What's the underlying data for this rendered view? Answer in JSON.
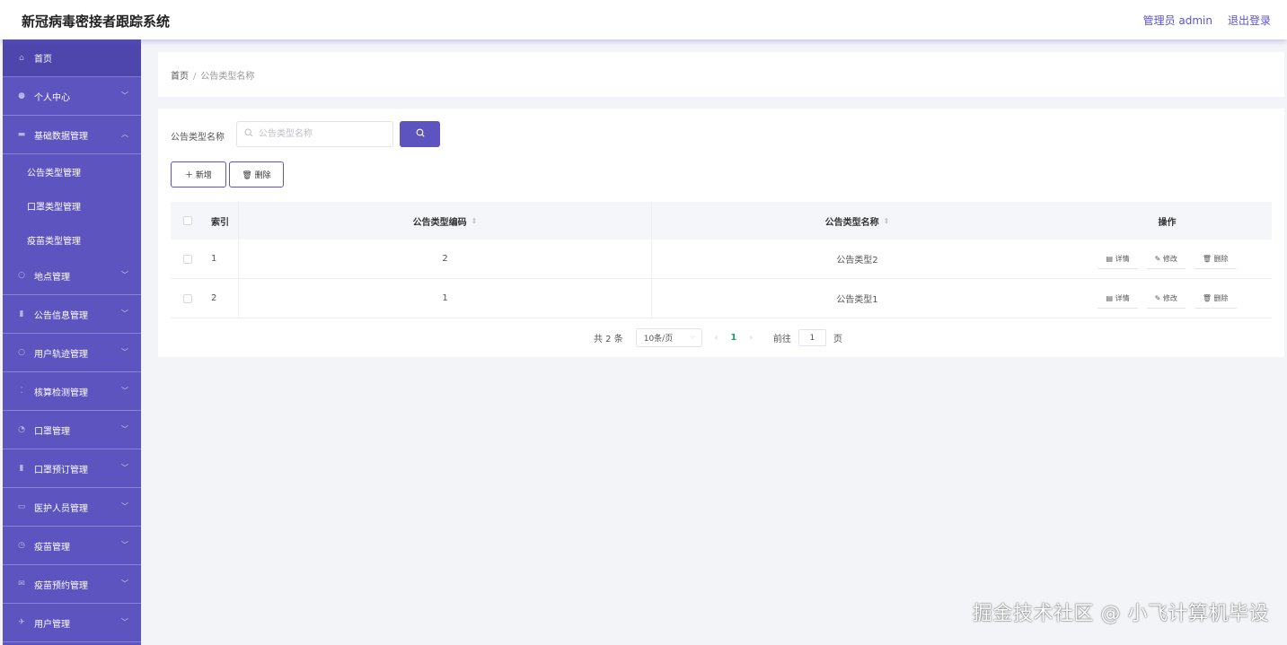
{
  "header": {
    "title": "新冠病毒密接者跟踪系统",
    "user_label": "管理员 admin",
    "logout_label": "退出登录"
  },
  "sidebar": {
    "items": [
      {
        "label": "首页",
        "icon": "home-icon",
        "glyph": "⌂",
        "expandable": false,
        "active": true
      },
      {
        "label": "个人中心",
        "icon": "user-icon",
        "glyph": "●",
        "expandable": true
      },
      {
        "label": "基础数据管理",
        "icon": "data-icon",
        "glyph": "▬",
        "expandable": true,
        "expanded": true,
        "children": [
          "公告类型管理",
          "口罩类型管理",
          "疫苗类型管理"
        ]
      },
      {
        "label": "地点管理",
        "icon": "location-icon",
        "glyph": "○",
        "expandable": true
      },
      {
        "label": "公告信息管理",
        "icon": "notice-icon",
        "glyph": "▮",
        "expandable": true
      },
      {
        "label": "用户轨迹管理",
        "icon": "track-icon",
        "glyph": "○",
        "expandable": true
      },
      {
        "label": "核算检测管理",
        "icon": "test-icon",
        "glyph": "⁚",
        "expandable": true
      },
      {
        "label": "口罩管理",
        "icon": "mask-icon",
        "glyph": "◔",
        "expandable": true
      },
      {
        "label": "口罩预订管理",
        "icon": "order-icon",
        "glyph": "▮",
        "expandable": true
      },
      {
        "label": "医护人员管理",
        "icon": "staff-icon",
        "glyph": "▭",
        "expandable": true
      },
      {
        "label": "疫苗管理",
        "icon": "vaccine-icon",
        "glyph": "◷",
        "expandable": true
      },
      {
        "label": "疫苗预约管理",
        "icon": "appointment-icon",
        "glyph": "✉",
        "expandable": true
      },
      {
        "label": "用户管理",
        "icon": "send-icon",
        "glyph": "✈",
        "expandable": true
      }
    ]
  },
  "breadcrumb": {
    "home": "首页",
    "separator": "/",
    "current": "公告类型名称"
  },
  "search": {
    "label": "公告类型名称",
    "placeholder": "公告类型名称",
    "button_icon": "search-icon"
  },
  "actions": {
    "add_label": "＋ 新增",
    "delete_label": "🗑 删除"
  },
  "table": {
    "headers": {
      "index": "索引",
      "code": "公告类型编码",
      "name": "公告类型名称",
      "ops": "操作"
    },
    "rows": [
      {
        "index": "1",
        "code": "2",
        "name": "公告类型2"
      },
      {
        "index": "2",
        "code": "1",
        "name": "公告类型1"
      }
    ],
    "row_ops": {
      "detail": "▤ 详情",
      "edit": "✎ 修改",
      "delete": "🗑 删除"
    }
  },
  "pagination": {
    "total_text": "共 2 条",
    "page_size": "10条/页",
    "current_page": "1",
    "goto_label": "前往",
    "goto_value": "1",
    "page_unit": "页"
  },
  "watermark": "掘金技术社区 @ 小飞计算机毕设",
  "colors": {
    "accent": "#5d54c0",
    "sidebar_active": "#4e45ad",
    "page_current": "#22a06b"
  }
}
